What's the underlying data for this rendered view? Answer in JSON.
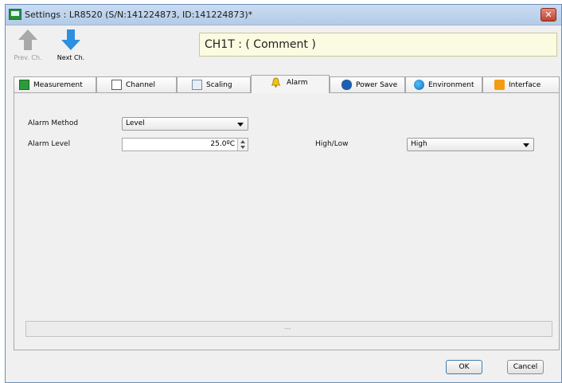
{
  "window": {
    "title": "Settings : LR8520 (S/N:141224873, ID:141224873)*",
    "close_glyph": "✕"
  },
  "toolbar": {
    "prev_label": "Prev. Ch.",
    "next_label": "Next Ch.",
    "prev_icon": "up-arrow-icon",
    "next_icon": "down-arrow-icon",
    "comment": "CH1T : ( Comment )"
  },
  "tabs": [
    {
      "label": "Measurement",
      "icon": "measurement-icon"
    },
    {
      "label": "Channel",
      "icon": "channel-icon"
    },
    {
      "label": "Scaling",
      "icon": "scaling-icon"
    },
    {
      "label": "Alarm",
      "icon": "bell-icon",
      "active": true
    },
    {
      "label": "Power Save",
      "icon": "bluetooth-icon"
    },
    {
      "label": "Environment",
      "icon": "globe-icon"
    },
    {
      "label": "Interface",
      "icon": "rss-icon"
    }
  ],
  "alarm": {
    "method_label": "Alarm Method",
    "method_value": "Level",
    "level_label": "Alarm Level",
    "level_value": "25.0ºC",
    "highlow_label": "High/Low",
    "highlow_value": "High"
  },
  "status": {
    "text": "---"
  },
  "buttons": {
    "ok": "OK",
    "cancel": "Cancel"
  },
  "colors": {
    "comment_bg": "#fbfbe1",
    "arrow_blue": "#2d8fe0",
    "arrow_gray": "#a8a8a8"
  }
}
